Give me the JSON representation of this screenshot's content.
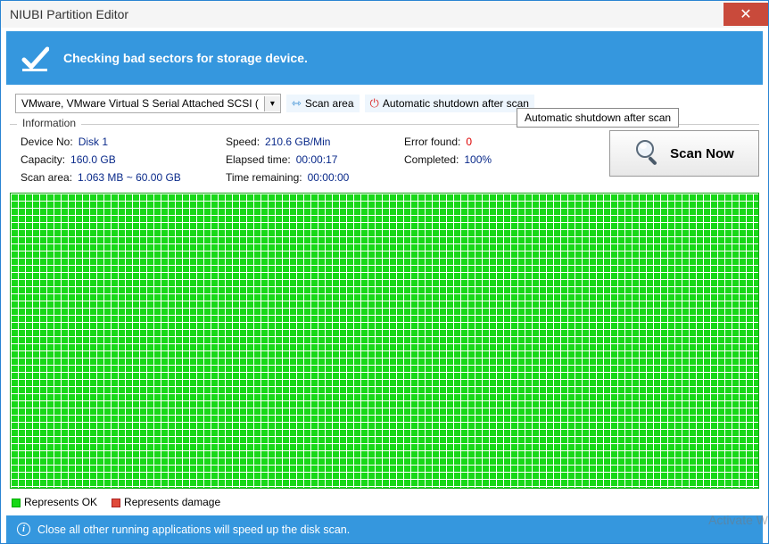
{
  "window": {
    "title": "NIUBI Partition Editor"
  },
  "banner": {
    "text": "Checking bad sectors for storage device."
  },
  "toolbar": {
    "device_selected": "VMware, VMware Virtual S Serial Attached SCSI (",
    "scan_area_label": "Scan area",
    "auto_shutdown_label": "Automatic shutdown after scan"
  },
  "tooltip": {
    "text": "Automatic shutdown after scan"
  },
  "info": {
    "section_label": "Information",
    "device_no_k": "Device No:",
    "device_no_v": "Disk 1",
    "capacity_k": "Capacity:",
    "capacity_v": "160.0 GB",
    "scan_area_k": "Scan area:",
    "scan_area_v": "1.063 MB ~ 60.00 GB",
    "speed_k": "Speed:",
    "speed_v": "210.6 GB/Min",
    "elapsed_k": "Elapsed time:",
    "elapsed_v": "00:00:17",
    "remaining_k": "Time remaining:",
    "remaining_v": "00:00:00",
    "error_k": "Error found:",
    "error_v": "0",
    "completed_k": "Completed:",
    "completed_v": "100%"
  },
  "scan_button": {
    "label": "Scan Now"
  },
  "legend": {
    "ok": "Represents OK",
    "damage": "Represents damage"
  },
  "footer": {
    "text": "Close all other running applications will speed up the disk scan."
  },
  "watermark": "Activate W"
}
